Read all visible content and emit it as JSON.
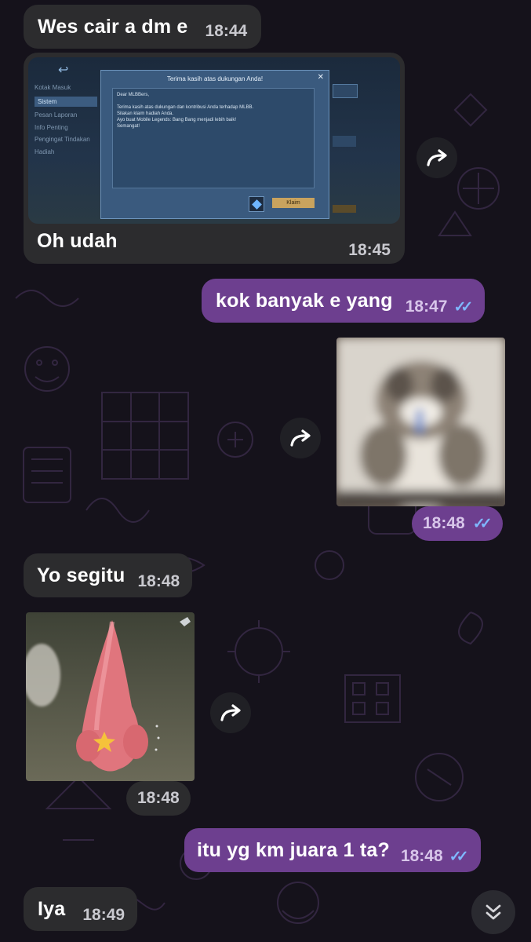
{
  "messages": [
    {
      "id": "m1",
      "direction": "in",
      "text": "Wes cair a dm e",
      "time": "18:44"
    },
    {
      "id": "m2",
      "direction": "in",
      "text": "Oh udah",
      "time": "18:45",
      "screenshot": {
        "dialog_title": "Terima kasih atas dukungan Anda!",
        "greeting": "Dear MLBBers,",
        "body_lines": [
          "Terima kasih atas dukungan dan kontribusi Anda terhadap MLBB.",
          "Silakan klaim hadiah Anda.",
          "Ayo buat Mobile Legends: Bang Bang menjadi lebih baik!",
          "Semangat!"
        ],
        "claim_label": "Klaim",
        "sidebar_items": [
          "Kotak Masuk",
          "Sistem",
          "Pesan Laporan",
          "Info Penting",
          "Pengingat Tindakan",
          "Hadiah"
        ]
      }
    },
    {
      "id": "m3",
      "direction": "out",
      "text": "kok banyak e yang",
      "time": "18:47"
    },
    {
      "id": "m4",
      "direction": "out",
      "media": "photo",
      "subject": "blurry-cat",
      "time": "18:48"
    },
    {
      "id": "m5",
      "direction": "in",
      "text": "Yo segitu",
      "time": "18:48"
    },
    {
      "id": "m6",
      "direction": "in",
      "media": "photo",
      "subject": "pink-cone-character",
      "time": "18:48"
    },
    {
      "id": "m7",
      "direction": "out",
      "text": "itu yg km juara 1 ta?",
      "time": "18:48"
    },
    {
      "id": "m8",
      "direction": "in",
      "text": "Iya",
      "time": "18:49"
    }
  ],
  "colors": {
    "background": "#15121b",
    "incoming_bubble": "#2c2c2e",
    "outgoing_bubble": "#6d3f8f",
    "read_ticks": "#7fb8ff"
  },
  "icons": {
    "forward": "forward-arrow-icon",
    "read_receipt": "double-check-icon",
    "scroll": "chevron-double-down-icon"
  }
}
